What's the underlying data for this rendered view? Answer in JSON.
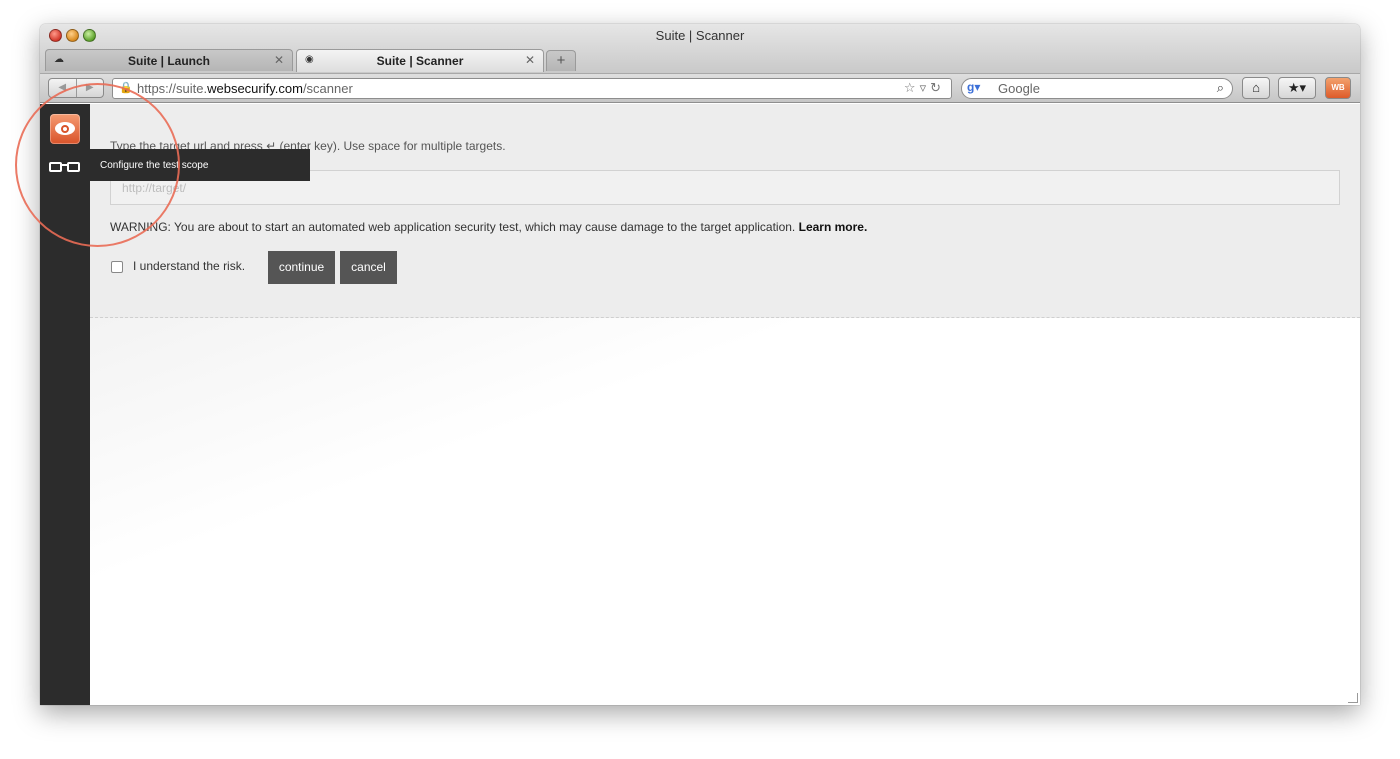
{
  "window": {
    "title": "Suite | Scanner"
  },
  "tabs": [
    {
      "label": "Suite | Launch",
      "icon": "cloud-icon",
      "active": false
    },
    {
      "label": "Suite | Scanner",
      "icon": "eye-icon",
      "active": true
    }
  ],
  "toolbar": {
    "url_prefix": "https://suite.",
    "url_domain": "websecurify.com",
    "url_path": "/scanner",
    "search_placeholder": "Google",
    "extension_label": "WB"
  },
  "sidebar": {
    "tooltip": "Configure the test scope"
  },
  "scanner": {
    "instruction": "Type the target url and press ↵ (enter key). Use space for multiple targets.",
    "target_placeholder": "http://target/",
    "warning_text": "WARNING: You are about to start an automated web application security test, which may cause damage to the target application.",
    "learn_more": "Learn more.",
    "risk_label": "I understand the risk.",
    "continue_label": "continue",
    "cancel_label": "cancel"
  },
  "colors": {
    "accent": "#dd5b2a",
    "sidebar": "#2c2c2c",
    "button": "#555555",
    "annotation": "#e96b55"
  }
}
